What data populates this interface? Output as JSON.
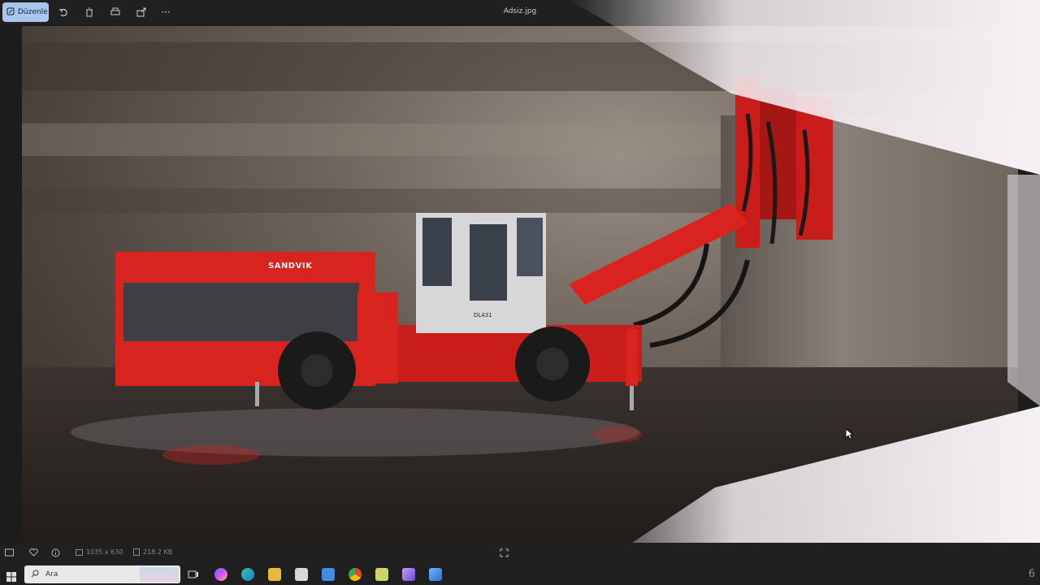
{
  "toolbar": {
    "edit_label": "Düzenle",
    "filename": "Adsiz.jpg",
    "icons": [
      "pencil-icon",
      "rotate-icon",
      "trash-icon",
      "print-icon",
      "share-icon",
      "more-icon"
    ],
    "more_glyph": "···"
  },
  "photo": {
    "rig_brand": "SANDVIK",
    "rig_model": "DL431"
  },
  "statusbar": {
    "dimensions": "1035 x 630",
    "filesize": "218.2 KB"
  },
  "taskbar": {
    "search_placeholder": "Ara"
  },
  "corner_number": "6",
  "colors": {
    "accent": "#a9c7ee",
    "rig_red": "#d8231f",
    "toolbar_bg": "#202020"
  }
}
